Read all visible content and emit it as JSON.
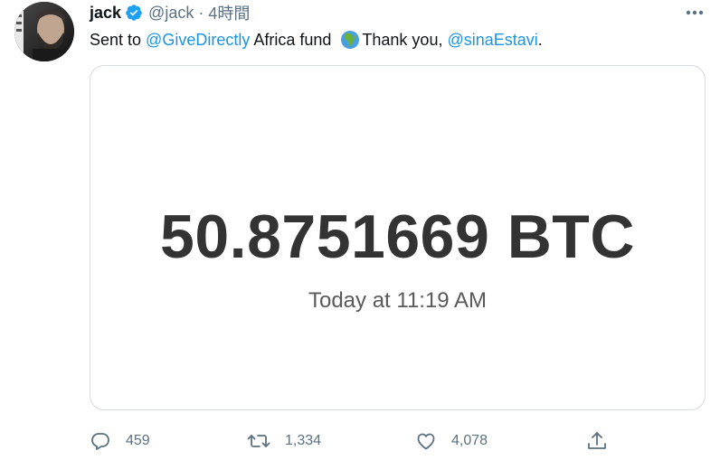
{
  "tweet": {
    "author": {
      "name": "jack",
      "handle": "@jack",
      "separator": "·",
      "time": "4時間"
    },
    "text": {
      "prefix": "Sent to ",
      "mention1": "@GiveDirectly",
      "middle": " Africa fund ",
      "emoji": "globe-africa-icon",
      "thanks": "Thank you, ",
      "mention2": "@sinaEstavi",
      "suffix": "."
    },
    "card": {
      "amount": "50.8751669 BTC",
      "time": "Today at 11:19 AM"
    },
    "actions": {
      "replies": "459",
      "retweets": "1,334",
      "likes": "4,078"
    }
  },
  "colors": {
    "link": "#1b95e0",
    "secondary_text": "#5b7083",
    "verified": "#1da1f2",
    "card_border": "#d4dbe1"
  }
}
